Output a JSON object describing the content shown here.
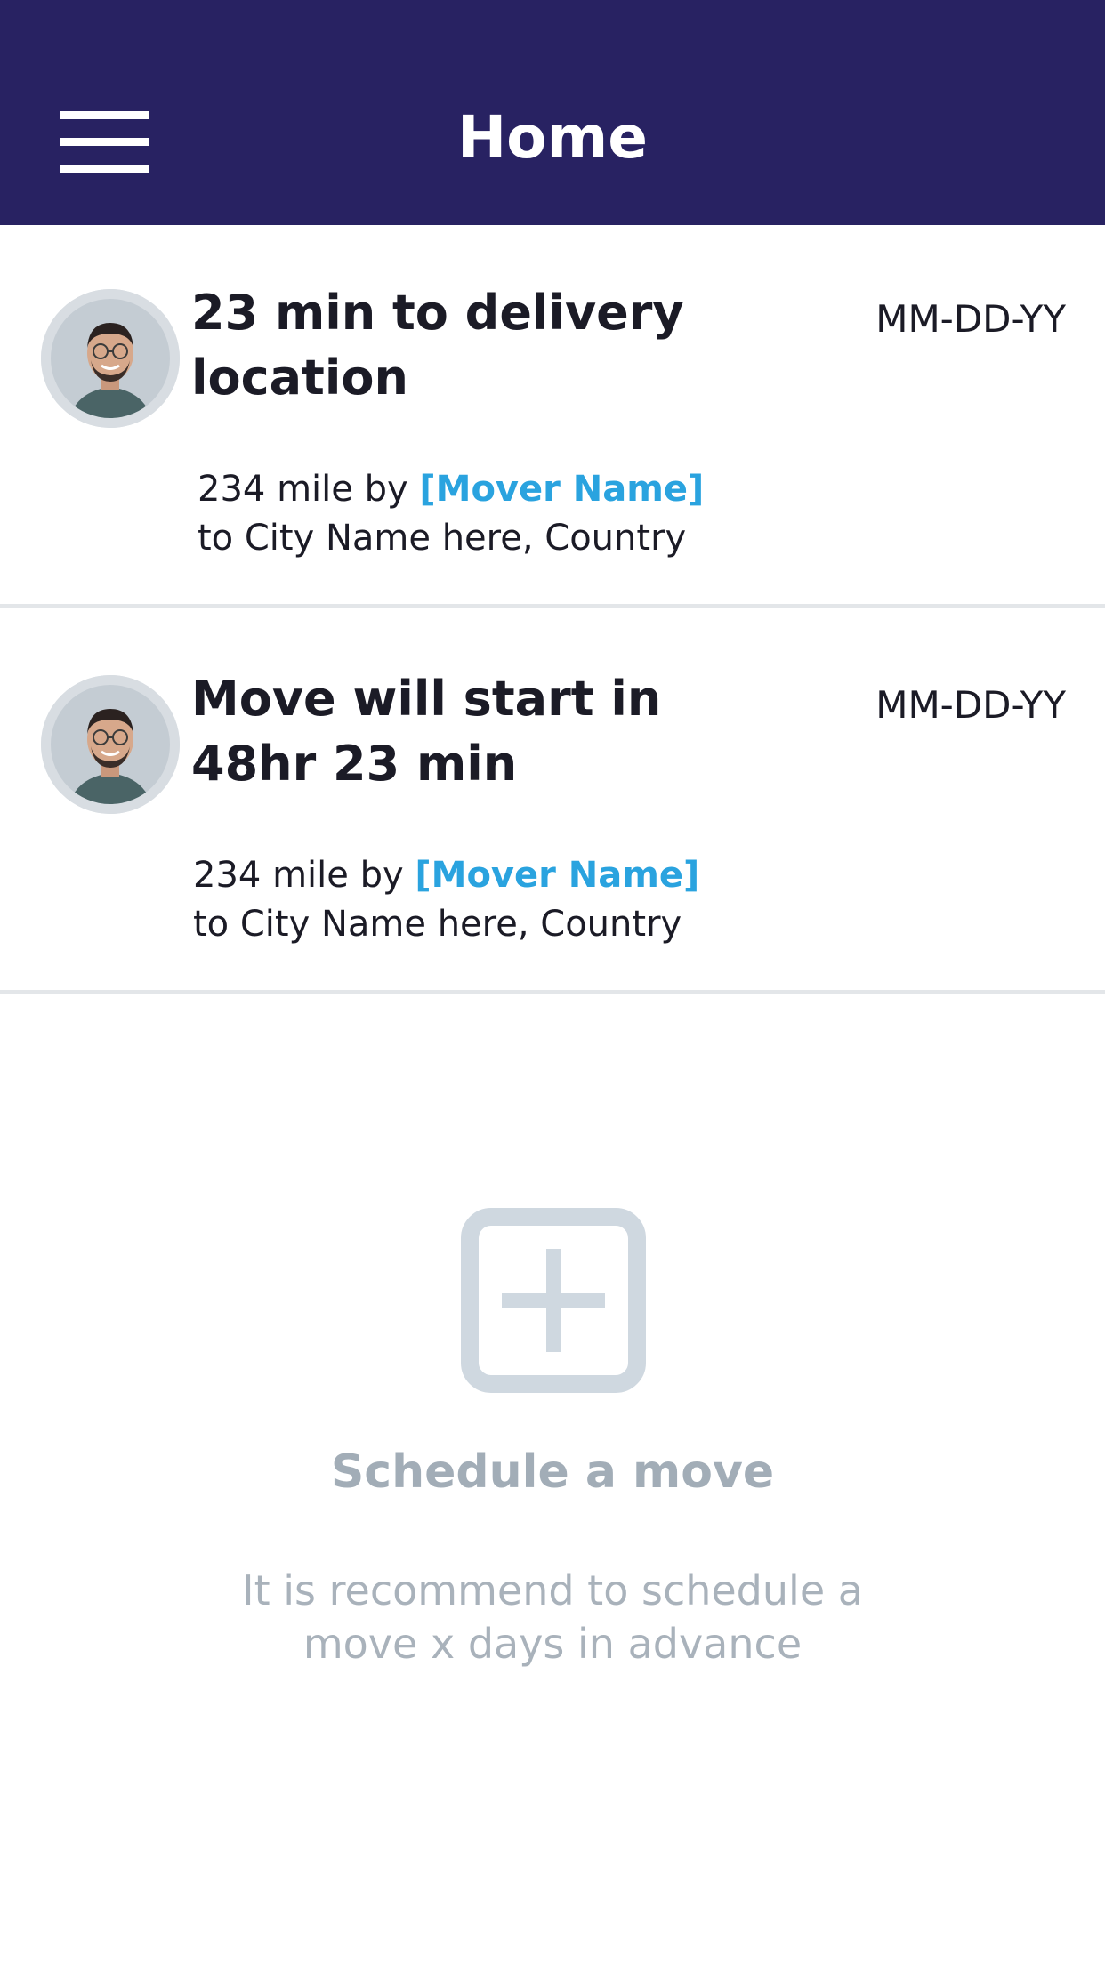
{
  "header": {
    "title": "Home",
    "background": "#282262",
    "menu_icon": "hamburger-menu-icon"
  },
  "moves": [
    {
      "title": "23 min to delivery location",
      "date": "MM-DD-YY",
      "distance_text": "234 mile by",
      "mover_name": "[Mover Name]",
      "destination": "to City Name here, Country"
    },
    {
      "title": "Move will start in 48hr 23 min",
      "date": "MM-DD-YY",
      "distance_text": "234 mile by",
      "mover_name": "[Mover Name]",
      "destination": "to City Name here, Country"
    }
  ],
  "schedule": {
    "icon": "add-square-icon",
    "title": "Schedule a move",
    "hint": "It is recommend to schedule a move x days in advance"
  },
  "colors": {
    "accent_link": "#2aa3df",
    "muted": "#a2adb7",
    "icon_gray": "#cfd8e0"
  }
}
